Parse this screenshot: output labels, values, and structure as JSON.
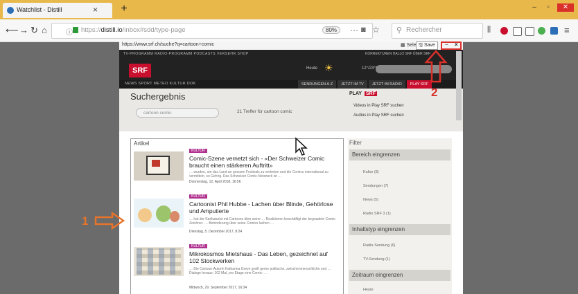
{
  "browser": {
    "tab_title": "Watchlist - Distill",
    "tab_close": "×",
    "new_tab": "+",
    "url_prefix": "https://",
    "url_domain": "distill.io",
    "url_path": "/inbox#sdd/type-page",
    "zoom": "80%",
    "more": "···",
    "search_placeholder": "Rechercher",
    "win_min": "‒",
    "win_max": "▫",
    "win_close": "✕"
  },
  "inner": {
    "url": "https://www.srf.ch/suche?q=cartoon+comic",
    "select_label": "Select",
    "save_label": "Save",
    "minus": "−",
    "close": "×"
  },
  "srf": {
    "top_links": "TV-PROGRAMM   RADIO-PROGRAMM   PODCASTS   VERSEHR   SHOP",
    "top_right": "KORREKTUREN   HALLO SRF   ÜBER SRF",
    "logo": "SRF",
    "weather": "Heute",
    "temp": "12°/23°C",
    "nav_left": "NEWS   SPORT   METEO   KULTUR   DOK",
    "nav_right": [
      "SENDUNGEN A-Z",
      "JETZT IM TV",
      "JETZT IM RADIO",
      "PLAY SRF"
    ]
  },
  "search": {
    "title": "Suchergebnis",
    "input_value": "cartoon comic",
    "result_count": "21 Treffer für cartoon comic",
    "play_label": "PLAY",
    "play_srf": "SRF",
    "videos_link": "Videos in Play SRF suchen",
    "audios_link": "Audios in Play SRF suchen"
  },
  "articles": {
    "header": "Artikel",
    "items": [
      {
        "badge": "KULTUR",
        "title": "Comic-Szene vernetzt sich - «Der Schweizer Comic braucht einen stärkeren Auftritt»",
        "snippet": "… wurden, um das Land an grossen Festivals zu vertreten und die Comics international zu vermitteln, so Gehrig. Das Schweizer Comic-Netzwerk ist …",
        "date": "Donnerstag, 12. April 2018, 16:56"
      },
      {
        "badge": "KULTUR",
        "title": "Cartoonist Phil Hubbe - Lachen über Blinde, Gehörlose und Amputierte",
        "snippet": "… hat der Karikaturist mit Cartoons über seine … Reaktionen beschäftigt der begnadete Comic-Zeichner. … Behinderung über seine Comics lachen …",
        "date": "Dienstag, 5. Dezember 2017, 8:24"
      },
      {
        "badge": "KULTUR",
        "title": "Mikrokosmos Mietshaus - Das Leben, gezeichnet auf 102 Stockwerken",
        "snippet": "… Die Cartoon-Autorin Katharina Greve greift gerne politische, zwischenmenschliche und … Dialoge heraus: 102 Mal, pro Etage eine Comic- …",
        "date": "Mittwoch, 29. September 2017, 16:34"
      }
    ]
  },
  "filter": {
    "header": "Filter",
    "sec1": "Bereich eingrenzen",
    "sec1_items": [
      "Kultur (8)",
      "Sendungen (7)",
      "News (5)",
      "Radio SRF 3 (1)"
    ],
    "sec2": "Inhaltstyp eingrenzen",
    "sec2_items": [
      "Radio-Sendung (6)",
      "TV-Sendung (1)"
    ],
    "sec3": "Zeitraum eingrenzen",
    "sec3_items": [
      "Heute"
    ]
  },
  "annotations": {
    "label_1": "1",
    "label_2": "2",
    "color": "#e8742a",
    "box_color": "#d9302a"
  }
}
